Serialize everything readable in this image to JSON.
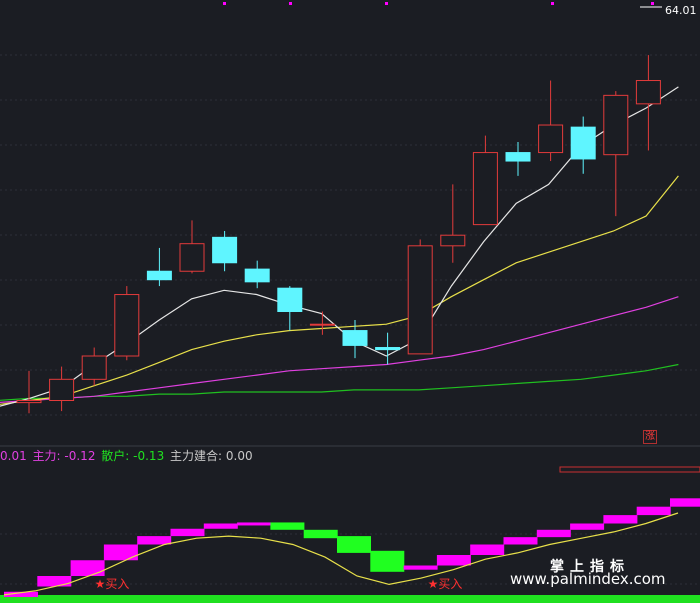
{
  "chart_data": [
    {
      "type": "candlestick",
      "title": "",
      "price_label": "64.01",
      "ylim": [
        43.5,
        64.5
      ],
      "colors": {
        "up": "#e33b3b",
        "down": "#5ff5ff",
        "ma5": "#e6e6e6",
        "ma10": "#e8e04a",
        "ma20": "#e040e0",
        "ma60": "#20c020"
      },
      "candles": [
        {
          "o": 45.5,
          "h": 47.0,
          "l": 45.0,
          "c": 45.6
        },
        {
          "o": 45.6,
          "h": 47.2,
          "l": 45.1,
          "c": 46.6
        },
        {
          "o": 46.6,
          "h": 48.1,
          "l": 46.3,
          "c": 47.7
        },
        {
          "o": 47.7,
          "h": 51.0,
          "l": 47.5,
          "c": 50.6
        },
        {
          "o": 51.7,
          "h": 52.8,
          "l": 51.0,
          "c": 51.3
        },
        {
          "o": 51.7,
          "h": 54.1,
          "l": 51.6,
          "c": 53.0
        },
        {
          "o": 53.3,
          "h": 53.6,
          "l": 51.7,
          "c": 52.1
        },
        {
          "o": 51.8,
          "h": 52.2,
          "l": 50.9,
          "c": 51.2
        },
        {
          "o": 50.9,
          "h": 51.0,
          "l": 48.9,
          "c": 49.8
        },
        {
          "o": 49.2,
          "h": 49.8,
          "l": 48.7,
          "c": 49.2
        },
        {
          "o": 48.9,
          "h": 49.4,
          "l": 47.6,
          "c": 48.2
        },
        {
          "o": 48.1,
          "h": 48.8,
          "l": 47.3,
          "c": 48.0
        },
        {
          "o": 47.8,
          "h": 53.2,
          "l": 47.8,
          "c": 52.9
        },
        {
          "o": 52.9,
          "h": 55.8,
          "l": 52.1,
          "c": 53.4
        },
        {
          "o": 53.9,
          "h": 58.1,
          "l": 53.9,
          "c": 57.3
        },
        {
          "o": 57.3,
          "h": 57.8,
          "l": 56.2,
          "c": 56.9
        },
        {
          "o": 57.3,
          "h": 60.7,
          "l": 56.9,
          "c": 58.6
        },
        {
          "o": 58.5,
          "h": 59.0,
          "l": 56.3,
          "c": 57.0
        },
        {
          "o": 57.2,
          "h": 60.2,
          "l": 54.3,
          "c": 60.0
        },
        {
          "o": 59.6,
          "h": 61.9,
          "l": 57.4,
          "c": 60.7
        }
      ],
      "ma5": [
        45.3,
        45.7,
        46.2,
        47.3,
        48.3,
        49.4,
        50.4,
        50.8,
        50.6,
        50.1,
        49.7,
        48.4,
        47.7,
        48.5,
        51.0,
        53.1,
        54.9,
        55.8,
        57.6,
        58.6,
        59.4,
        60.4
      ],
      "ma10": [
        45.4,
        45.6,
        45.8,
        46.3,
        46.8,
        47.4,
        48.0,
        48.4,
        48.7,
        48.9,
        49.0,
        49.1,
        49.2,
        49.6,
        50.5,
        51.3,
        52.1,
        52.6,
        53.1,
        53.6,
        54.3,
        56.2
      ],
      "ma20": [
        45.5,
        45.6,
        45.7,
        45.8,
        46.0,
        46.2,
        46.4,
        46.6,
        46.8,
        47.0,
        47.1,
        47.2,
        47.3,
        47.5,
        47.7,
        48.0,
        48.4,
        48.8,
        49.2,
        49.6,
        50.0,
        50.5
      ],
      "ma60": [
        45.6,
        45.7,
        45.7,
        45.8,
        45.8,
        45.9,
        45.9,
        46.0,
        46.0,
        46.0,
        46.0,
        46.1,
        46.1,
        46.1,
        46.2,
        46.3,
        46.4,
        46.5,
        46.6,
        46.8,
        47.0,
        47.3
      ]
    },
    {
      "type": "bar",
      "title": "",
      "legend": [
        {
          "label": "0.01",
          "color": "#e040e0"
        },
        {
          "label": "主力: -0.12",
          "color": "#e040e0"
        },
        {
          "label": "散户: -0.13",
          "color": "#20e020"
        },
        {
          "label": "主力建合: 0.00",
          "color": "#c8c8c8"
        }
      ],
      "ylim": [
        0,
        100
      ],
      "bars": [
        {
          "o": 5,
          "c": 0,
          "color": "#ff00ff"
        },
        {
          "o": 10,
          "c": 20,
          "color": "#ff00ff"
        },
        {
          "o": 20,
          "c": 35,
          "color": "#ff00ff"
        },
        {
          "o": 35,
          "c": 50,
          "color": "#ff00ff"
        },
        {
          "o": 50,
          "c": 58,
          "color": "#ff00ff"
        },
        {
          "o": 58,
          "c": 65,
          "color": "#ff00ff"
        },
        {
          "o": 65,
          "c": 70,
          "color": "#ff00ff"
        },
        {
          "o": 70,
          "c": 71,
          "color": "#ff00ff"
        },
        {
          "o": 71,
          "c": 64,
          "color": "#20ff20"
        },
        {
          "o": 64,
          "c": 56,
          "color": "#20ff20"
        },
        {
          "o": 58,
          "c": 42,
          "color": "#20ff20"
        },
        {
          "o": 44,
          "c": 24,
          "color": "#20ff20"
        },
        {
          "o": 26,
          "c": 30,
          "color": "#ff00ff"
        },
        {
          "o": 30,
          "c": 40,
          "color": "#ff00ff"
        },
        {
          "o": 40,
          "c": 50,
          "color": "#ff00ff"
        },
        {
          "o": 50,
          "c": 57,
          "color": "#ff00ff"
        },
        {
          "o": 57,
          "c": 64,
          "color": "#ff00ff"
        },
        {
          "o": 64,
          "c": 70,
          "color": "#ff00ff"
        },
        {
          "o": 70,
          "c": 78,
          "color": "#ff00ff"
        },
        {
          "o": 78,
          "c": 86,
          "color": "#ff00ff"
        },
        {
          "o": 86,
          "c": 94,
          "color": "#ff00ff"
        }
      ],
      "line": [
        2,
        6,
        13,
        24,
        38,
        50,
        56,
        58,
        56,
        50,
        38,
        20,
        12,
        18,
        26,
        36,
        42,
        50,
        56,
        62,
        70,
        80
      ],
      "signals": [
        {
          "index": 2,
          "label": "★买入"
        },
        {
          "index": 12,
          "label": "★买入"
        }
      ]
    }
  ],
  "watermark": {
    "line1": "掌上指标",
    "line2": "www.palmindex.com"
  },
  "badge": "涨"
}
